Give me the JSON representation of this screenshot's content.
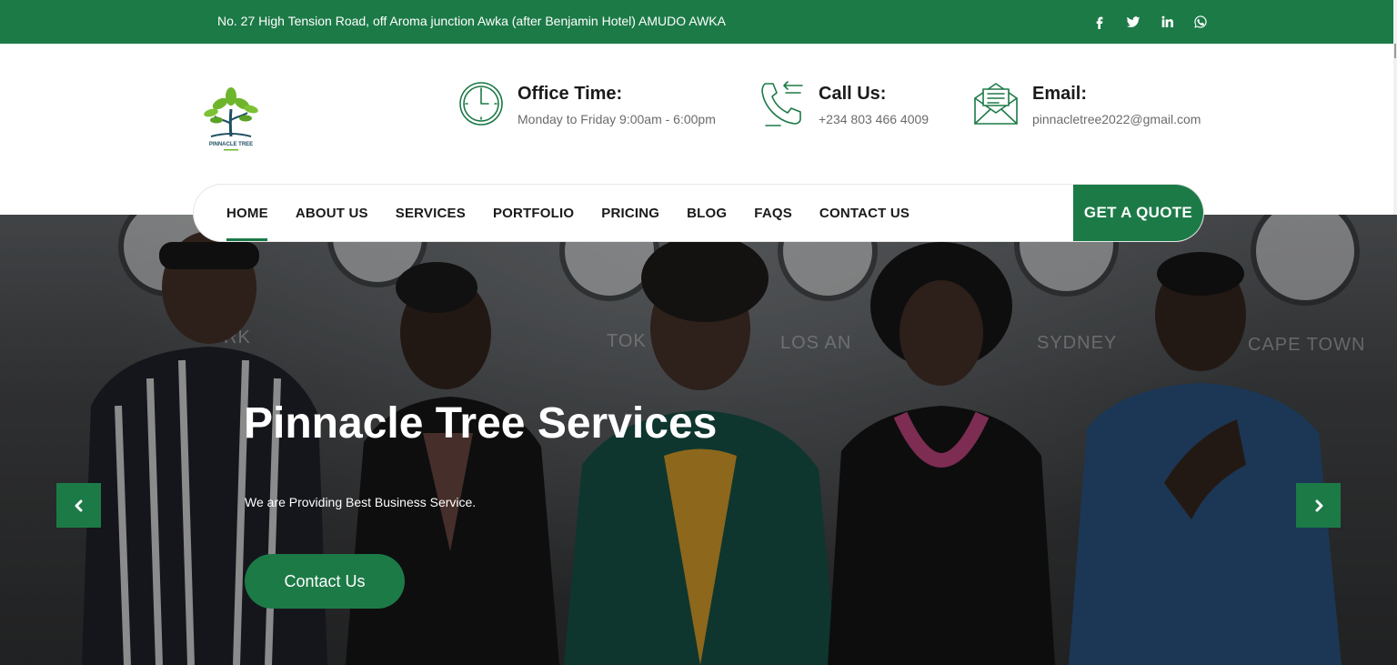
{
  "topbar": {
    "address": "No. 27 High Tension Road, off Aroma junction Awka (after Benjamin Hotel) AMUDO AWKA",
    "socials": [
      "facebook-icon",
      "twitter-icon",
      "linkedin-icon",
      "whatsapp-icon"
    ]
  },
  "header": {
    "logo_text": "PINNACLE TREE",
    "office": {
      "title": "Office Time:",
      "value": "Monday to Friday 9:00am - 6:00pm",
      "icon": "clock-icon"
    },
    "call": {
      "title": "Call Us:",
      "value": "+234 803 466 4009",
      "icon": "phone-icon"
    },
    "email": {
      "title": "Email:",
      "value": "pinnacletree2022@gmail.com",
      "icon": "envelope-icon"
    }
  },
  "nav": {
    "items": [
      "HOME",
      "ABOUT US",
      "SERVICES",
      "PORTFOLIO",
      "PRICING",
      "BLOG",
      "FAQS",
      "CONTACT US"
    ],
    "active": "HOME",
    "quote_label": "GET A QUOTE"
  },
  "hero": {
    "title": "Pinnacle Tree Services",
    "subtitle": "We are Providing Best Business Service.",
    "button_label": "Contact Us",
    "wall_labels": [
      "RK",
      "TOK",
      "LOS AN",
      "SYDNEY",
      "CAPE TOWN"
    ]
  },
  "colors": {
    "brand": "#1c7a47",
    "text": "#1a1a1a",
    "muted": "#6b6b6b"
  }
}
